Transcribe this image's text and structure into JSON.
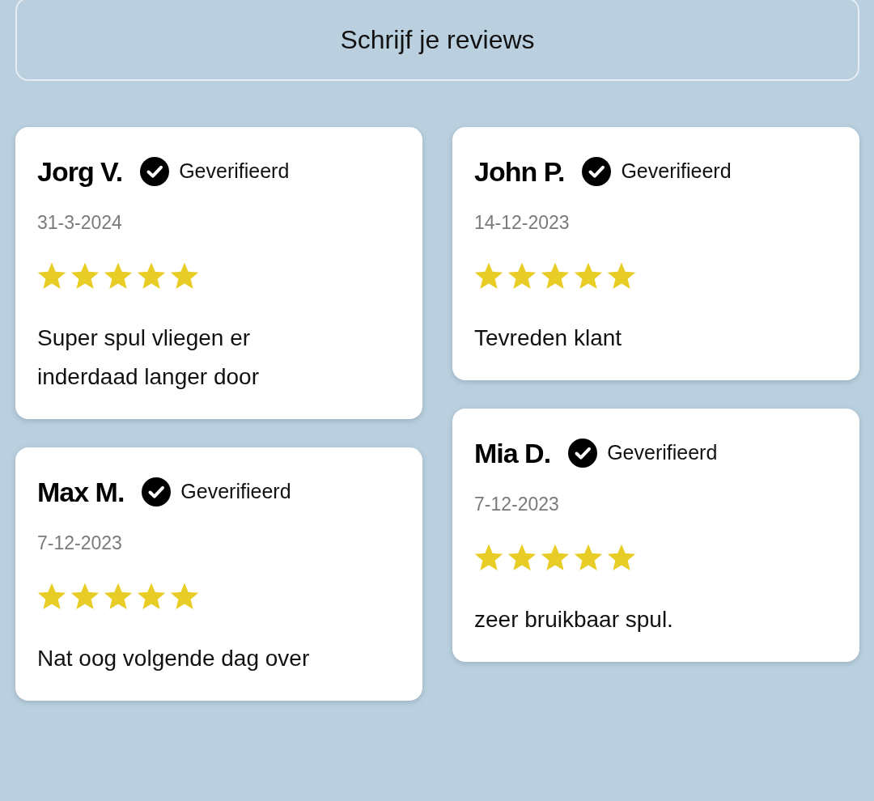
{
  "write_button": {
    "label": "Schrijf je reviews"
  },
  "columns": [
    {
      "reviews": [
        {
          "name": "Jorg V.",
          "badge": "Geverifieerd",
          "date": "31-3-2024",
          "stars": 5,
          "text": "Super spul vliegen er inderdaad langer door"
        },
        {
          "name": "Max M.",
          "badge": "Geverifieerd",
          "date": "7-12-2023",
          "stars": 5,
          "text": "Nat oog volgende dag over"
        }
      ]
    },
    {
      "reviews": [
        {
          "name": "John P.",
          "badge": "Geverifieerd",
          "date": "14-12-2023",
          "stars": 5,
          "text": "Tevreden klant"
        },
        {
          "name": "Mia D.",
          "badge": "Geverifieerd",
          "date": "7-12-2023",
          "stars": 5,
          "text": "zeer bruikbaar spul."
        }
      ]
    }
  ]
}
